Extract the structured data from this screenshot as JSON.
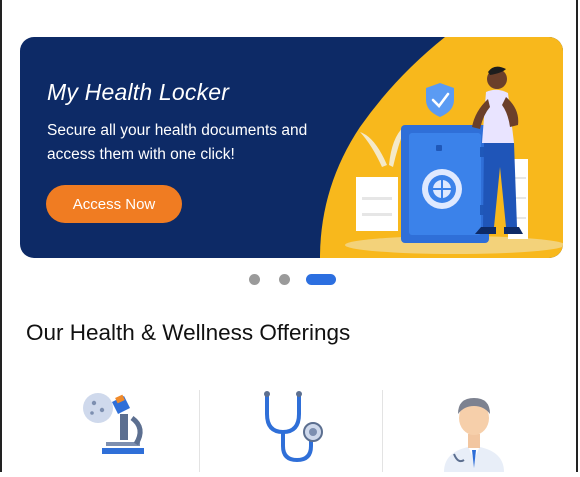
{
  "banner": {
    "title": "My Health Locker",
    "subtitle": "Secure all your health documents and access them with one click!",
    "button_label": "Access Now",
    "colors": {
      "navy": "#0d2a66",
      "yellow": "#f8b81c",
      "orange": "#f07c22"
    }
  },
  "carousel": {
    "total": 3,
    "active_index": 2
  },
  "section": {
    "title": "Our Health & Wellness Offerings"
  },
  "offerings": [
    {
      "icon": "microscope-icon"
    },
    {
      "icon": "stethoscope-icon"
    },
    {
      "icon": "doctor-icon"
    }
  ]
}
